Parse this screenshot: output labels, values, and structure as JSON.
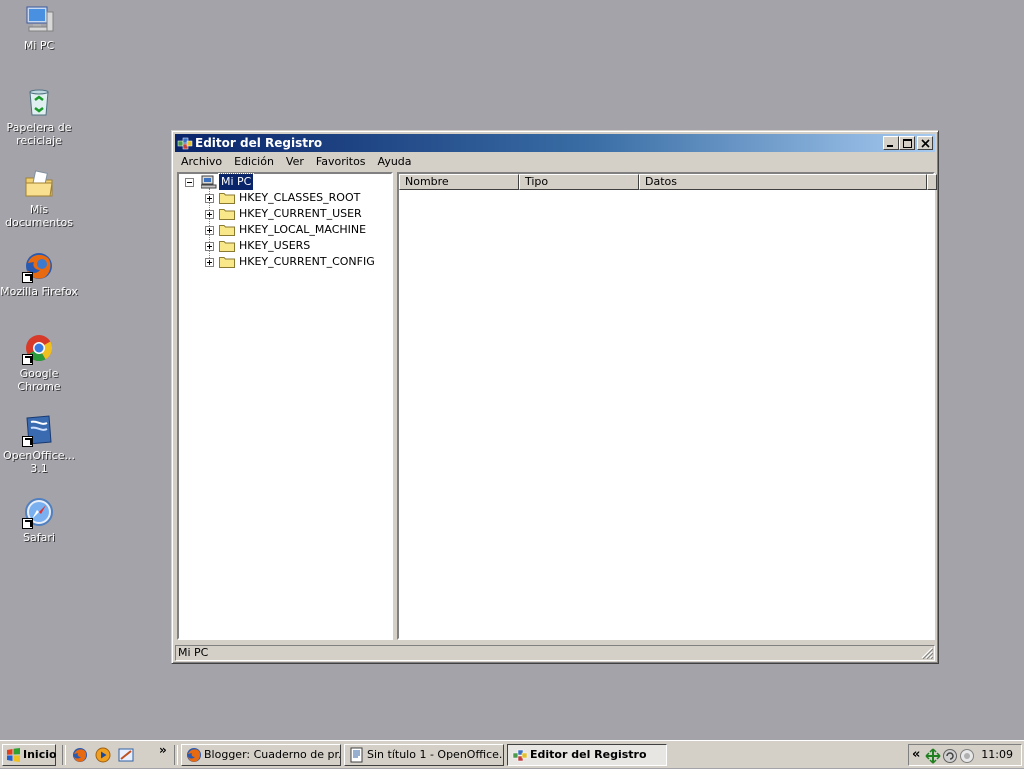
{
  "desktop": {
    "icons": [
      {
        "label": "Mi PC",
        "icon": "my-computer-icon"
      },
      {
        "label": "Papelera de reciclaje",
        "icon": "recycle-bin-icon"
      },
      {
        "label": "Mis documentos",
        "icon": "my-documents-icon"
      },
      {
        "label": "Mozilla Firefox",
        "icon": "firefox-icon"
      },
      {
        "label": "Google Chrome",
        "icon": "chrome-icon"
      },
      {
        "label": "OpenOffice... 3.1",
        "icon": "openoffice-icon"
      },
      {
        "label": "Safari",
        "icon": "safari-icon"
      }
    ]
  },
  "window": {
    "title": "Editor del Registro",
    "menu": [
      "Archivo",
      "Edición",
      "Ver",
      "Favoritos",
      "Ayuda"
    ],
    "tree": {
      "root": "Mi PC",
      "keys": [
        "HKEY_CLASSES_ROOT",
        "HKEY_CURRENT_USER",
        "HKEY_LOCAL_MACHINE",
        "HKEY_USERS",
        "HKEY_CURRENT_CONFIG"
      ]
    },
    "columns": [
      "Nombre",
      "Tipo",
      "Datos"
    ],
    "status": "Mi PC"
  },
  "taskbar": {
    "start_label": "Inicio",
    "more_label": "»",
    "tasks": [
      {
        "label": "Blogger: Cuaderno de pr...",
        "icon": "firefox-icon",
        "active": false
      },
      {
        "label": "Sin título 1 - OpenOffice....",
        "icon": "openoffice-writer-icon",
        "active": false
      },
      {
        "label": "Editor del Registro",
        "icon": "regedit-icon",
        "active": true
      }
    ],
    "tray_chevron": "«",
    "clock": "11:09"
  },
  "colors": {
    "desktop": "#a4a3aa",
    "title_start": "#0a246a",
    "title_end": "#a6caf0",
    "face": "#d4d0c8",
    "selection": "#0a246a"
  }
}
